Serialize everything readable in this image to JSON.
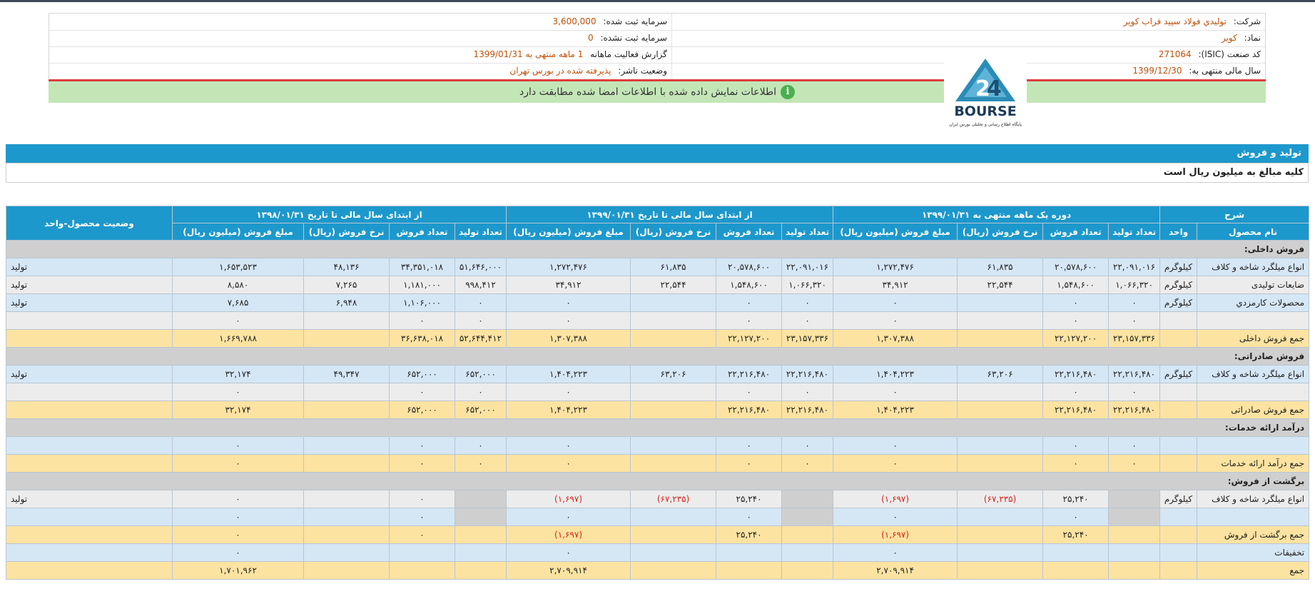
{
  "company": {
    "company_label": "شرکت:",
    "company_value": "توليدي فولاد سپيد فراب کوير",
    "symbol_label": "نماد:",
    "symbol_value": "کویر",
    "isic_label": "کد صنعت (ISIC):",
    "isic_value": "271064",
    "fy_label": "سال مالی منتهی به:",
    "fy_value": "1399/12/30",
    "capital_label": "سرمایه ثبت شده:",
    "capital_value": "3,600,000",
    "unreg_label": "سرمایه ثبت نشده:",
    "unreg_value": "0",
    "report_label": "گزارش فعالیت ماهانه",
    "report_value": "1 ماهه منتهی به 1399/01/31",
    "status_label": "وضعیت ناشر:",
    "status_value": "پذیرفته شده در بورس تهران"
  },
  "logo": {
    "text": "BOURSE",
    "caption": "پایگاه اطلاع رسانی و تحلیلی بورس ایران"
  },
  "alert": {
    "text": "اطلاعات نمایش داده شده با اطلاعات امضا شده مطابقت دارد",
    "icon": "i"
  },
  "section": {
    "title": "تولید و فروش",
    "note": "کلیه مبالغ به میلیون ریال است"
  },
  "table": {
    "group_headers": {
      "desc": "شرح",
      "g1": "دوره یک ماهه منتهی به ۱۳۹۹/۰۱/۳۱",
      "g2": "از ابتدای سال مالی تا تاریخ ۱۳۹۹/۰۱/۳۱",
      "g3": "از ابتدای سال مالی تا تاریخ ۱۳۹۸/۰۱/۳۱",
      "status": "وضعیت محصول-واحد"
    },
    "sub_headers": {
      "product": "نام محصول",
      "unit": "واحد",
      "prod_qty": "تعداد تولید",
      "sales_qty": "تعداد فروش",
      "rate": "نرخ فروش (ریال)",
      "amount": "مبلغ فروش (میلیون ریال)"
    },
    "rows": [
      {
        "type": "section",
        "label": "فروش داخلی:"
      },
      {
        "type": "blue",
        "name": "انواع میلگرد شاخه و کلاف",
        "unit": "کیلوگرم",
        "p1": "۲۲,۰۹۱,۰۱۶",
        "s1": "۲۰,۵۷۸,۶۰۰",
        "r1": "۶۱,۸۳۵",
        "a1": "۱,۲۷۲,۴۷۶",
        "p2": "۲۲,۰۹۱,۰۱۶",
        "s2": "۲۰,۵۷۸,۶۰۰",
        "r2": "۶۱,۸۳۵",
        "a2": "۱,۲۷۲,۴۷۶",
        "p3": "۵۱,۶۴۶,۰۰۰",
        "s3": "۳۴,۳۵۱,۰۱۸",
        "r3": "۴۸,۱۳۶",
        "a3": "۱,۶۵۳,۵۲۳",
        "st": "تولید"
      },
      {
        "type": "gray",
        "name": "ضایعات تولیدی",
        "unit": "کیلوگرم",
        "p1": "۱,۰۶۶,۳۲۰",
        "s1": "۱,۵۴۸,۶۰۰",
        "r1": "۲۲,۵۴۴",
        "a1": "۳۴,۹۱۲",
        "p2": "۱,۰۶۶,۳۲۰",
        "s2": "۱,۵۴۸,۶۰۰",
        "r2": "۲۲,۵۴۴",
        "a2": "۳۴,۹۱۲",
        "p3": "۹۹۸,۴۱۲",
        "s3": "۱,۱۸۱,۰۰۰",
        "r3": "۷,۲۶۵",
        "a3": "۸,۵۸۰",
        "st": "تولید"
      },
      {
        "type": "blue",
        "name": "محصولات کارمزدي",
        "unit": "کیلوگرم",
        "p1": "۰",
        "s1": "۰",
        "r1": "",
        "a1": "۰",
        "p2": "۰",
        "s2": "۰",
        "r2": "",
        "a2": "۰",
        "p3": "۰",
        "s3": "۱,۱۰۶,۰۰۰",
        "r3": "۶,۹۴۸",
        "a3": "۷,۶۸۵",
        "st": "تولید"
      },
      {
        "type": "gray",
        "name": "",
        "unit": "",
        "p1": "۰",
        "s1": "۰",
        "r1": "",
        "a1": "۰",
        "p2": "۰",
        "s2": "۰",
        "r2": "",
        "a2": "۰",
        "p3": "۰",
        "s3": "۰",
        "r3": "",
        "a3": "۰",
        "st": ""
      },
      {
        "type": "total",
        "name": "جمع فروش داخلی",
        "unit": "",
        "p1": "۲۳,۱۵۷,۳۳۶",
        "s1": "۲۲,۱۲۷,۲۰۰",
        "r1": "",
        "a1": "۱,۳۰۷,۳۸۸",
        "p2": "۲۳,۱۵۷,۳۳۶",
        "s2": "۲۲,۱۲۷,۲۰۰",
        "r2": "",
        "a2": "۱,۳۰۷,۳۸۸",
        "p3": "۵۲,۶۴۴,۴۱۲",
        "s3": "۳۶,۶۳۸,۰۱۸",
        "r3": "",
        "a3": "۱,۶۶۹,۷۸۸",
        "st": ""
      },
      {
        "type": "section",
        "label": "فروش صادراتی:"
      },
      {
        "type": "blue",
        "name": "انواع میلگرد شاخه و کلاف",
        "unit": "کیلوگرم",
        "p1": "۲۲,۲۱۶,۴۸۰",
        "s1": "۲۲,۲۱۶,۴۸۰",
        "r1": "۶۳,۲۰۶",
        "a1": "۱,۴۰۴,۲۲۳",
        "p2": "۲۲,۲۱۶,۴۸۰",
        "s2": "۲۲,۲۱۶,۴۸۰",
        "r2": "۶۳,۲۰۶",
        "a2": "۱,۴۰۴,۲۲۳",
        "p3": "۶۵۲,۰۰۰",
        "s3": "۶۵۲,۰۰۰",
        "r3": "۴۹,۳۴۷",
        "a3": "۳۲,۱۷۴",
        "st": "تولید"
      },
      {
        "type": "gray",
        "name": "",
        "unit": "",
        "p1": "۰",
        "s1": "۰",
        "r1": "",
        "a1": "۰",
        "p2": "۰",
        "s2": "۰",
        "r2": "",
        "a2": "۰",
        "p3": "۰",
        "s3": "۰",
        "r3": "",
        "a3": "۰",
        "st": ""
      },
      {
        "type": "total",
        "name": "جمع فروش صادراتی",
        "unit": "",
        "p1": "۲۲,۲۱۶,۴۸۰",
        "s1": "۲۲,۲۱۶,۴۸۰",
        "r1": "",
        "a1": "۱,۴۰۴,۲۲۳",
        "p2": "۲۲,۲۱۶,۴۸۰",
        "s2": "۲۲,۲۱۶,۴۸۰",
        "r2": "",
        "a2": "۱,۴۰۴,۲۲۳",
        "p3": "۶۵۲,۰۰۰",
        "s3": "۶۵۲,۰۰۰",
        "r3": "",
        "a3": "۳۲,۱۷۴",
        "st": ""
      },
      {
        "type": "section",
        "label": "درآمد ارائه خدمات:"
      },
      {
        "type": "blue",
        "name": "",
        "unit": "",
        "p1": "۰",
        "s1": "۰",
        "r1": "",
        "a1": "۰",
        "p2": "۰",
        "s2": "۰",
        "r2": "",
        "a2": "۰",
        "p3": "۰",
        "s3": "۰",
        "r3": "",
        "a3": "۰",
        "st": ""
      },
      {
        "type": "total",
        "name": "جمع درآمد ارائه خدمات",
        "unit": "",
        "p1": "۰",
        "s1": "۰",
        "r1": "",
        "a1": "۰",
        "p2": "۰",
        "s2": "۰",
        "r2": "",
        "a2": "۰",
        "p3": "۰",
        "s3": "۰",
        "r3": "",
        "a3": "۰",
        "st": ""
      },
      {
        "type": "section",
        "label": "برگشت از فروش:"
      },
      {
        "type": "gray",
        "name": "انواع میلگرد شاخه و کلاف",
        "unit": "کیلوگرم",
        "p1": "",
        "s1": "۲۵,۲۴۰",
        "r1": "(۶۷,۲۳۵)",
        "a1": "(۱,۶۹۷)",
        "p2": "",
        "s2": "۲۵,۲۴۰",
        "r2": "(۶۷,۲۳۵)",
        "a2": "(۱,۶۹۷)",
        "p3": "",
        "s3": "۰",
        "r3": "",
        "a3": "۰",
        "st": "تولید",
        "shadeP": true
      },
      {
        "type": "blue",
        "name": "",
        "unit": "",
        "p1": "",
        "s1": "۰",
        "r1": "",
        "a1": "۰",
        "p2": "",
        "s2": "۰",
        "r2": "",
        "a2": "۰",
        "p3": "",
        "s3": "۰",
        "r3": "",
        "a3": "۰",
        "st": "",
        "shadeP": true
      },
      {
        "type": "total",
        "name": "جمع برگشت از فروش",
        "unit": "",
        "p1": "",
        "s1": "۲۵,۲۴۰",
        "r1": "",
        "a1": "(۱,۶۹۷)",
        "p2": "",
        "s2": "۲۵,۲۴۰",
        "r2": "",
        "a2": "(۱,۶۹۷)",
        "p3": "",
        "s3": "۰",
        "r3": "",
        "a3": "۰",
        "st": ""
      },
      {
        "type": "blue",
        "name": "تخفیفات",
        "unit": "",
        "p1": "",
        "s1": "",
        "r1": "",
        "a1": "۰",
        "p2": "",
        "s2": "",
        "r2": "",
        "a2": "۰",
        "p3": "",
        "s3": "",
        "r3": "",
        "a3": "۰",
        "st": ""
      },
      {
        "type": "total",
        "name": "جمع",
        "unit": "",
        "p1": "",
        "s1": "",
        "r1": "",
        "a1": "۲,۷۰۹,۹۱۴",
        "p2": "",
        "s2": "",
        "r2": "",
        "a2": "۲,۷۰۹,۹۱۴",
        "p3": "",
        "s3": "",
        "r3": "",
        "a3": "۱,۷۰۱,۹۶۲",
        "st": ""
      }
    ]
  }
}
